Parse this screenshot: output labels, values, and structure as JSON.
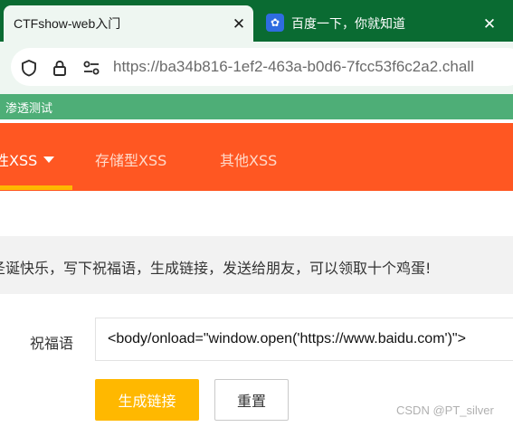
{
  "browser": {
    "tabs": [
      {
        "title": "CTFshow-web入门",
        "close_glyph": "✕",
        "active": true
      },
      {
        "title": "百度一下，你就知道",
        "close_glyph": "✕",
        "active": false,
        "favicon": "baidu-paw-icon",
        "favicon_glyph": "✿",
        "favicon_color": "#2f6ce0"
      }
    ],
    "address_bar": {
      "url": "https://ba34b816-1ef2-463a-b0d6-7fcc53f6c2a2.chall",
      "icons": [
        "shield-icon",
        "lock-icon",
        "site-permissions-icon"
      ]
    },
    "bookmarks": [
      {
        "label": "渗透测试"
      }
    ]
  },
  "page": {
    "nav": {
      "items": [
        {
          "label": "性XSS",
          "active": true,
          "has_dropdown": true
        },
        {
          "label": "存储型XSS",
          "active": false
        },
        {
          "label": "其他XSS",
          "active": false
        }
      ],
      "accent_color": "#ff5722",
      "active_underline_color": "#ffb800"
    },
    "notice": "圣诞快乐，写下祝福语，生成链接，发送给朋友，可以领取十个鸡蛋!",
    "form": {
      "label": "祝福语",
      "input_value": "<body/onload=\"window.open('https://www.baidu.com')\">",
      "submit_label": "生成链接",
      "reset_label": "重置",
      "submit_color": "#ffb800"
    }
  },
  "watermark": "CSDN @PT_silver"
}
